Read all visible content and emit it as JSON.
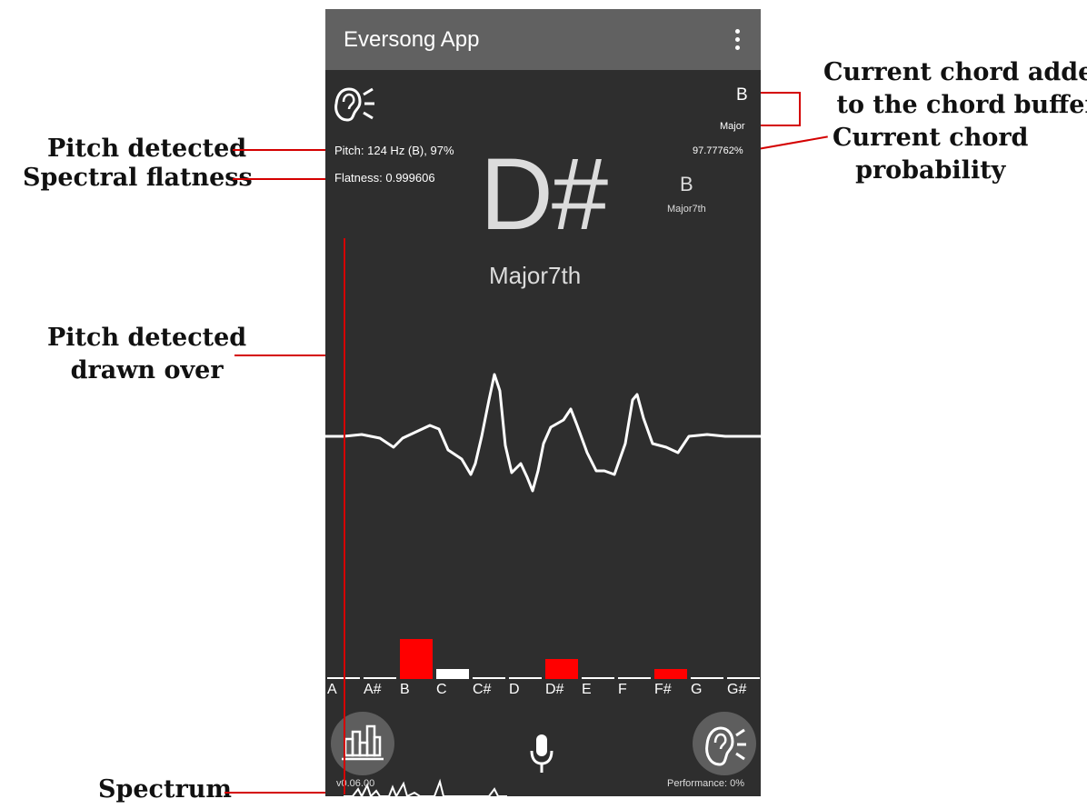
{
  "app": {
    "title": "Eversong App"
  },
  "detection": {
    "pitch_text": "Pitch: 124 Hz (B), 97%",
    "flatness_text": "Flatness: 0.999606"
  },
  "chord": {
    "note": "D#",
    "type": "Major7th"
  },
  "secondary_chord": {
    "note": "B",
    "type": "Major7th"
  },
  "buffer_chord": {
    "note": "B",
    "type": "Major",
    "probability": "97.77762%"
  },
  "notes": {
    "labels": [
      "A",
      "A#",
      "B",
      "C",
      "C#",
      "D",
      "D#",
      "E",
      "F",
      "F#",
      "G",
      "G#"
    ],
    "levels": [
      0,
      0,
      0.8,
      0.2,
      0,
      0,
      0.4,
      0,
      0,
      0.2,
      0,
      0
    ],
    "highlighted": [
      "B",
      "D#",
      "F#"
    ]
  },
  "footer": {
    "version": "v0.06.00",
    "performance": "Performance: 0%"
  },
  "annotations": {
    "pitch_detected": "Pitch detected",
    "spectral_flatness": "Spectral flatness",
    "pitch_drawn_line1": "Pitch detected",
    "pitch_drawn_line2": "drawn over",
    "spectrum": "Spectrum",
    "chord_added_line1": "Current chord added",
    "chord_added_line2": "to the chord buffer",
    "chord_prob_line1": "Current chord",
    "chord_prob_line2": "probability"
  },
  "colors": {
    "highlight": "#ff0000",
    "bar": "#ffffff",
    "annotation_line": "#d40000",
    "background": "#2e2e2e",
    "appbar": "#616161"
  },
  "icons": {
    "menu": "more-vert-icon",
    "ear": "ear-listening-icon",
    "spectrum": "bar-chart-icon",
    "mic": "microphone-icon"
  }
}
